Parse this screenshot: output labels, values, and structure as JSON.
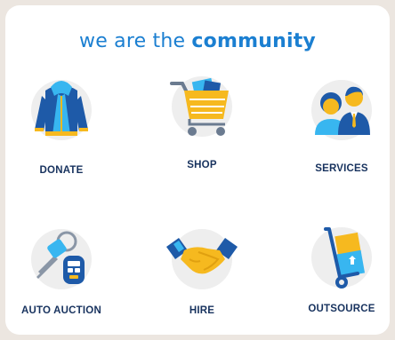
{
  "header": {
    "prefix": "we are the ",
    "highlight": "community"
  },
  "tiles": [
    {
      "label": "DONATE",
      "icon": "hoodie-icon"
    },
    {
      "label": "SHOP",
      "icon": "shopping-cart-icon"
    },
    {
      "label": "SERVICES",
      "icon": "people-icon"
    },
    {
      "label": "AUTO AUCTION",
      "icon": "car-keys-icon"
    },
    {
      "label": "HIRE",
      "icon": "handshake-icon"
    },
    {
      "label": "OUTSOURCE",
      "icon": "hand-truck-icon"
    }
  ],
  "colors": {
    "primary_blue": "#1b7fd1",
    "navy": "#17325e",
    "yellow": "#f6b91f",
    "light_blue": "#38b6f0",
    "circle_bg": "#eeeeee",
    "page_bg": "#ece6e0"
  }
}
